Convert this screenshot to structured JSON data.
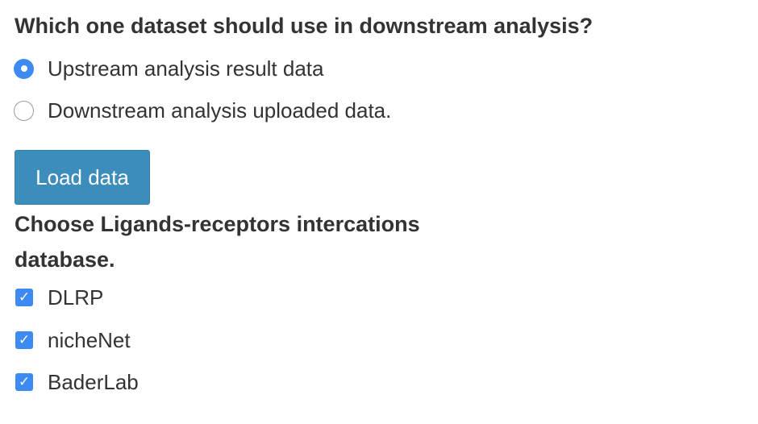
{
  "dataset_question": {
    "title": "Which one dataset should use in downstream analysis?",
    "options": [
      {
        "label": "Upstream analysis result data",
        "selected": true
      },
      {
        "label": "Downstream analysis uploaded data.",
        "selected": false
      }
    ]
  },
  "load_button": {
    "label": "Load data"
  },
  "lr_database": {
    "title": "Choose Ligands-receptors intercations database.",
    "options": [
      {
        "label": "DLRP",
        "checked": true
      },
      {
        "label": "nicheNet",
        "checked": true
      },
      {
        "label": "BaderLab",
        "checked": true
      }
    ]
  },
  "colors": {
    "accent": "#3d8bf0",
    "button": "#3c8dbc",
    "text": "#333333"
  },
  "icons": {
    "radio_selected": "radio-selected-icon",
    "radio_unselected": "radio-unselected-icon",
    "checkbox_checked": "checkbox-checked-icon"
  }
}
